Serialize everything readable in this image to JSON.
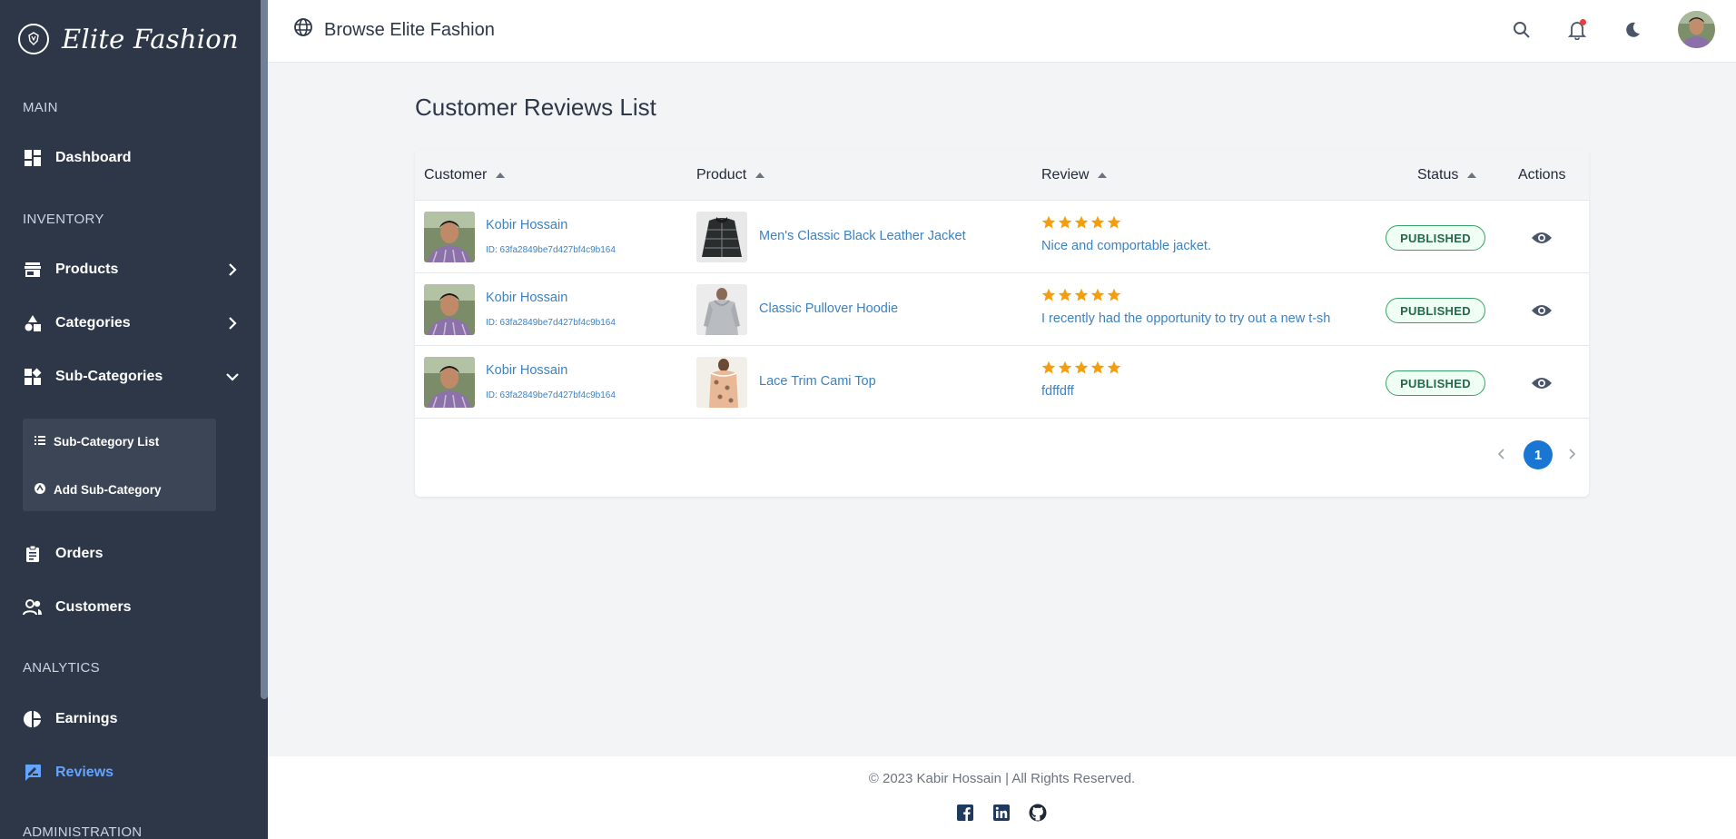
{
  "sidebar": {
    "logo_text": "Elite Fashion",
    "sections": {
      "main": "MAIN",
      "inventory": "INVENTORY",
      "analytics": "ANALYTICS",
      "administration": "ADMINISTRATION"
    },
    "items": {
      "dashboard": "Dashboard",
      "products": "Products",
      "categories": "Categories",
      "sub_categories": "Sub-Categories",
      "orders": "Orders",
      "customers": "Customers",
      "earnings": "Earnings",
      "reviews": "Reviews"
    },
    "submenu": {
      "list": "Sub-Category List",
      "add": "Add Sub-Category"
    },
    "active_item": "Reviews",
    "active_color": "#63a4ff"
  },
  "header": {
    "brand": "Browse Elite Fashion",
    "icons": [
      "globe-icon",
      "search-icon",
      "bell-icon",
      "moon-icon",
      "avatar"
    ]
  },
  "page": {
    "title": "Customer Reviews List"
  },
  "table": {
    "columns": {
      "customer": "Customer",
      "product": "Product",
      "review": "Review",
      "status": "Status",
      "actions": "Actions"
    },
    "rows": [
      {
        "customer_name": "Kobir Hossain",
        "customer_id": "ID: 63fa2849be7d427bf4c9b164",
        "product": "Men's Classic Black Leather Jacket",
        "rating": 5,
        "review": "Nice and comportable jacket.",
        "status": "PUBLISHED"
      },
      {
        "customer_name": "Kobir Hossain",
        "customer_id": "ID: 63fa2849be7d427bf4c9b164",
        "product": "Classic Pullover Hoodie",
        "rating": 5,
        "review": "I recently had the opportunity to try out a new t-sh",
        "status": "PUBLISHED"
      },
      {
        "customer_name": "Kobir Hossain",
        "customer_id": "ID: 63fa2849be7d427bf4c9b164",
        "product": "Lace Trim Cami Top",
        "rating": 5,
        "review": "fdffdff",
        "status": "PUBLISHED"
      }
    ]
  },
  "pagination": {
    "current_page": "1"
  },
  "footer": {
    "copyright": "© 2023 Kabir Hossain | All Rights Reserved.",
    "social": [
      "facebook-icon",
      "linkedin-icon",
      "github-icon"
    ]
  },
  "colors": {
    "sidebar_bg": "#2d3748",
    "link": "#3b82c4",
    "star": "#f59e0b",
    "badge_border": "#38a169",
    "pager_active": "#1976d2"
  }
}
